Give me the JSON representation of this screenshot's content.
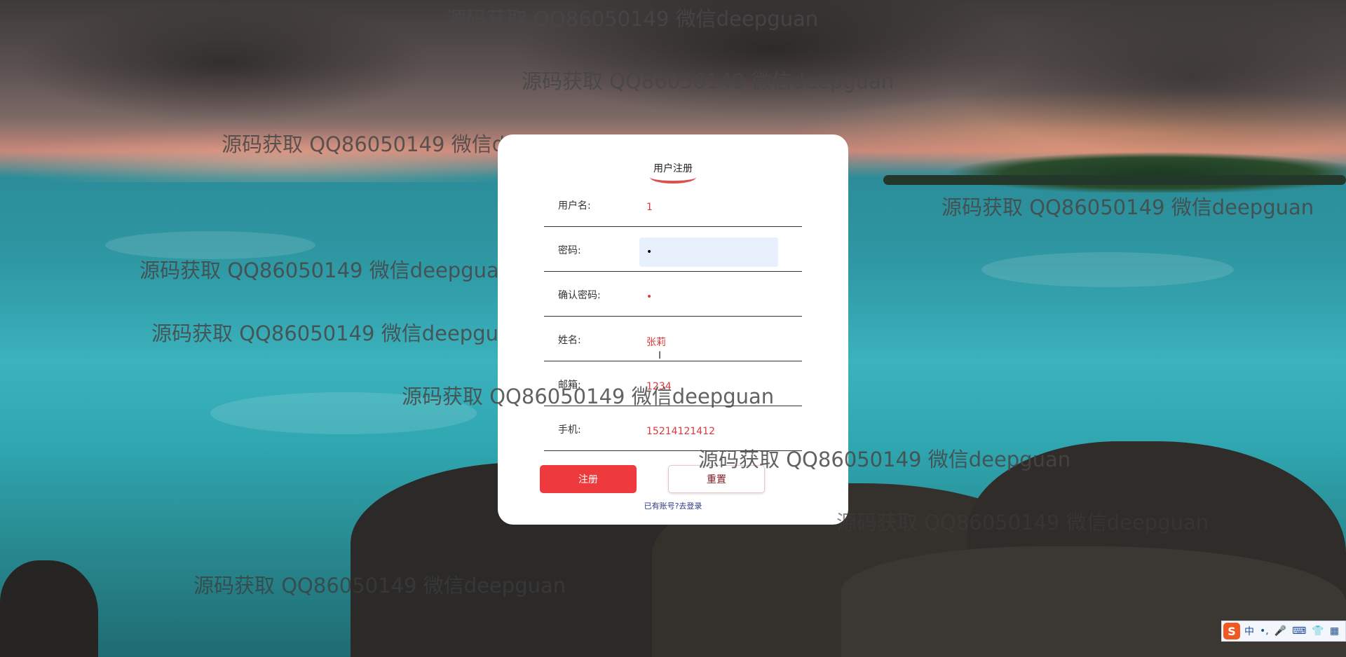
{
  "form": {
    "title": "用户注册",
    "fields": [
      {
        "label": "用户名:",
        "value": "1"
      },
      {
        "label": "密码:",
        "value": "•"
      },
      {
        "label": "确认密码:",
        "value": "•"
      },
      {
        "label": "姓名:",
        "value": "张莉"
      },
      {
        "label": "邮箱:",
        "value": "1234"
      },
      {
        "label": "手机:",
        "value": "15214121412"
      }
    ],
    "register_label": "注册",
    "reset_label": "重置",
    "login_link": "已有账号?去登录"
  },
  "watermark": "源码获取 QQ86050149 微信deepguan",
  "ime": {
    "logo": "S",
    "items": [
      "中",
      "•,",
      "🎤",
      "⌨",
      "👕",
      "▦"
    ]
  }
}
